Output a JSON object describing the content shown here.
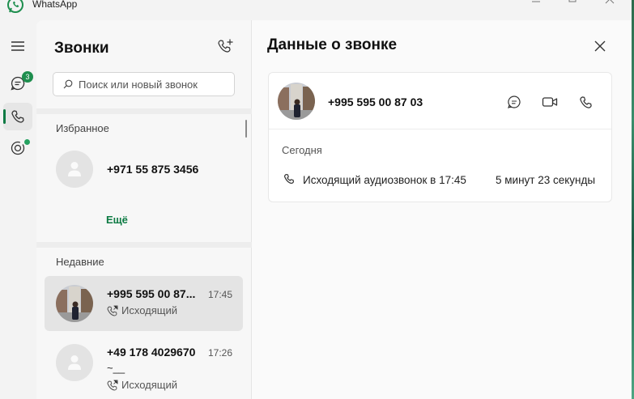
{
  "window": {
    "app_title": "WhatsApp"
  },
  "rail": {
    "chats_badge": "3"
  },
  "calls": {
    "title": "Звонки",
    "search_placeholder": "Поиск или новый звонок",
    "favorites_label": "Избранное",
    "favorite": {
      "name": "+971 55 875 3456"
    },
    "more_label": "Ещё",
    "recent_label": "Недавние",
    "recent": [
      {
        "name": "+995 595 00 87...",
        "time": "17:45",
        "type": "Исходящий",
        "selected": true
      },
      {
        "name": "+49 178 4029670",
        "time": "17:26",
        "extra": "~__",
        "type": "Исходящий",
        "selected": false
      }
    ]
  },
  "details": {
    "title": "Данные о звонке",
    "number": "+995 595 00 87 03",
    "day": "Сегодня",
    "call_description": "Исходящий аудиозвонок в 17:45",
    "duration": "5 минут 23 секунды"
  },
  "colors": {
    "accent": "#0c7a43",
    "badge": "#1e8e4e",
    "selected_row": "#e4e4e4"
  }
}
